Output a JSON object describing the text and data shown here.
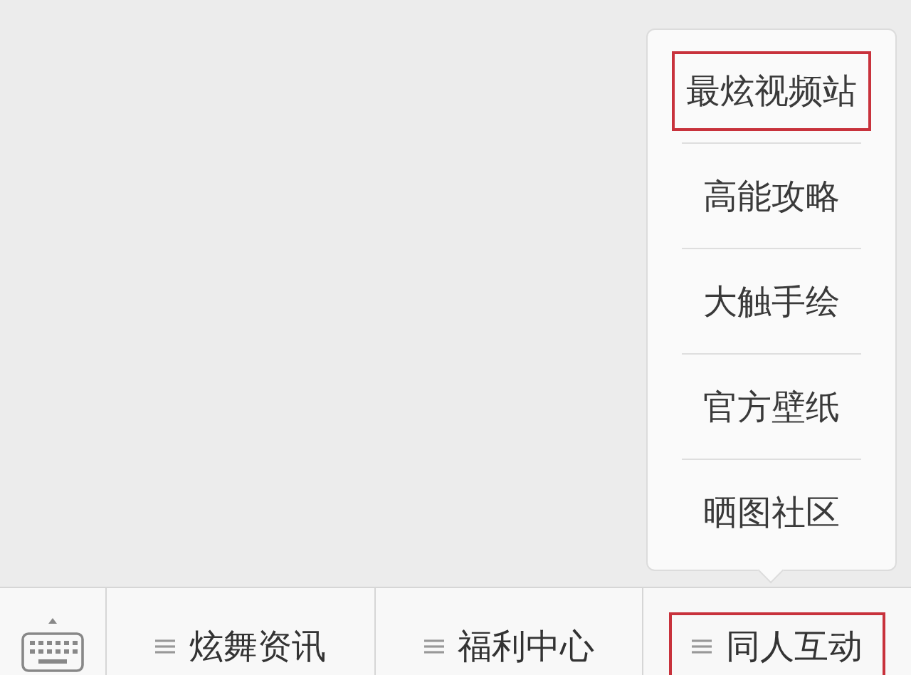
{
  "popup_menu": {
    "items": [
      {
        "label": "最炫视频站",
        "highlighted": true
      },
      {
        "label": "高能攻略",
        "highlighted": false
      },
      {
        "label": "大触手绘",
        "highlighted": false
      },
      {
        "label": "官方壁纸",
        "highlighted": false
      },
      {
        "label": "晒图社区",
        "highlighted": false
      }
    ]
  },
  "bottom_menu": {
    "items": [
      {
        "label": "炫舞资讯",
        "highlighted": false
      },
      {
        "label": "福利中心",
        "highlighted": false
      },
      {
        "label": "同人互动",
        "highlighted": true
      }
    ]
  }
}
